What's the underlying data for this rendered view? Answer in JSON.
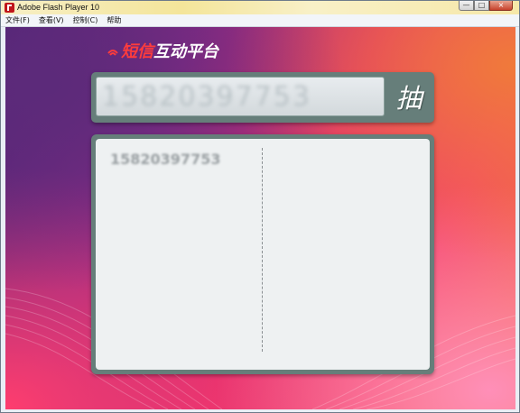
{
  "window": {
    "title": "Adobe Flash Player 10",
    "controls": {
      "minimize": "—",
      "maximize": "□",
      "close": "×"
    }
  },
  "menu": {
    "items": [
      "文件(F)",
      "查看(V)",
      "控制(C)",
      "帮助"
    ]
  },
  "app": {
    "logo_red": "短信",
    "logo_white": "互动平台",
    "phone_number": "15820397753",
    "draw_button_label": "抽",
    "list": {
      "entries": [
        "15820397753"
      ]
    }
  },
  "colors": {
    "accent_red": "#ff3c3c",
    "panel": "#667e7a",
    "panel_inner": "#eef1f2"
  }
}
